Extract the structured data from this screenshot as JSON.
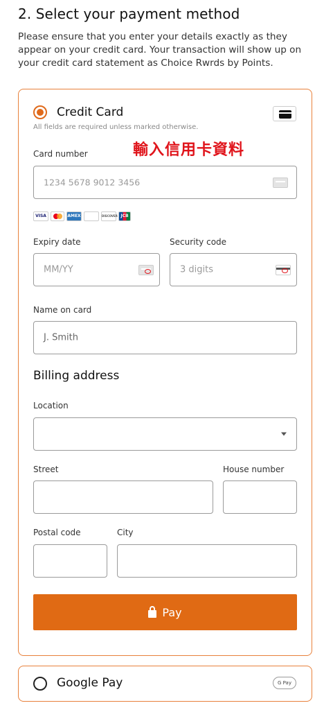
{
  "header": {
    "title": "2. Select your payment method",
    "intro": "Please ensure that you enter your details exactly as they appear on your credit card. Your transaction will show up on your credit card statement as Choice Rwrds by Points."
  },
  "credit_card": {
    "title": "Credit Card",
    "note": "All fields are required unless marked otherwise.",
    "annotation": "輸入信用卡資料",
    "selected": true,
    "card_number": {
      "label": "Card number",
      "placeholder": "1234 5678 9012 3456"
    },
    "brands": [
      "VISA",
      "",
      "AMEX",
      "",
      "DISCOVER",
      "JCB"
    ],
    "expiry": {
      "label": "Expiry date",
      "placeholder": "MM/YY"
    },
    "security": {
      "label": "Security code",
      "placeholder": "3 digits"
    },
    "name": {
      "label": "Name on card",
      "placeholder": "J. Smith"
    }
  },
  "billing": {
    "title": "Billing address",
    "location_label": "Location",
    "location_value": "",
    "street_label": "Street",
    "house_label": "House number",
    "postal_label": "Postal code",
    "city_label": "City"
  },
  "pay_button": {
    "label": "Pay"
  },
  "google_pay": {
    "title": "Google Pay",
    "badge": "G Pay",
    "selected": false
  },
  "colors": {
    "accent": "#e06a14",
    "border_accent": "#e8803a",
    "annotation": "#e0141b"
  },
  "icons": [
    "card-icon",
    "card-chip-icon",
    "cvc-icon",
    "lock-icon",
    "dropdown-arrow-icon",
    "google-pay-icon"
  ]
}
